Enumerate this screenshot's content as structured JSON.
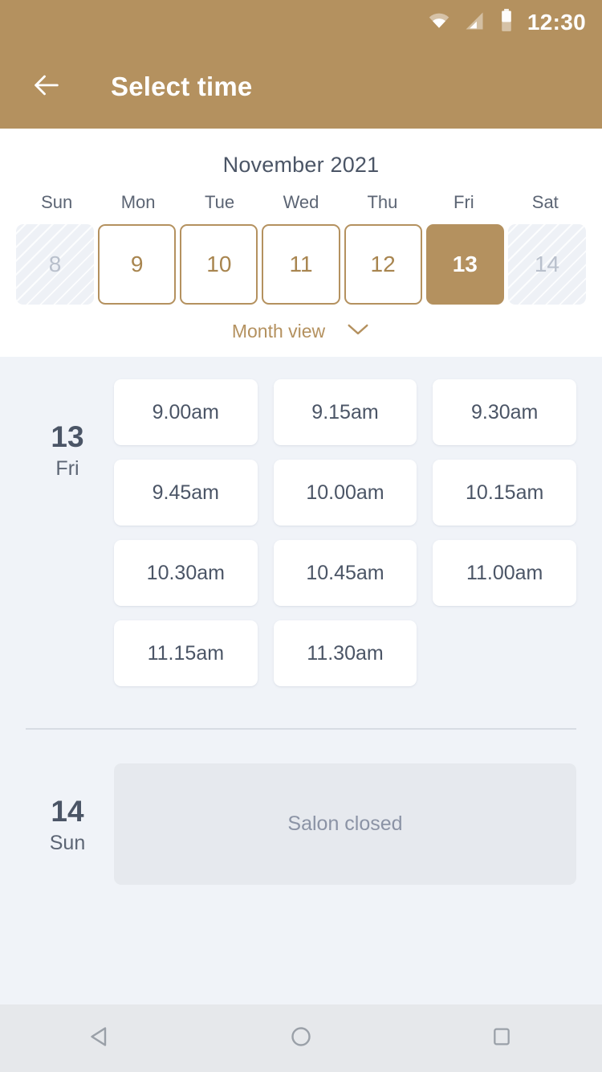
{
  "status_bar": {
    "time": "12:30",
    "icons": [
      "wifi-icon",
      "signal-icon",
      "battery-icon"
    ]
  },
  "app_bar": {
    "back_icon": "back-arrow-icon",
    "title": "Select time"
  },
  "calendar": {
    "month_title": "November 2021",
    "weekdays": [
      "Sun",
      "Mon",
      "Tue",
      "Wed",
      "Thu",
      "Fri",
      "Sat"
    ],
    "days": [
      {
        "number": "8",
        "state": "disabled"
      },
      {
        "number": "9",
        "state": "enabled"
      },
      {
        "number": "10",
        "state": "enabled"
      },
      {
        "number": "11",
        "state": "enabled"
      },
      {
        "number": "12",
        "state": "enabled"
      },
      {
        "number": "13",
        "state": "selected"
      },
      {
        "number": "14",
        "state": "disabled"
      }
    ],
    "view_toggle": {
      "label": "Month view",
      "icon": "chevron-down-icon"
    }
  },
  "schedule": [
    {
      "day_number": "13",
      "day_name": "Fri",
      "slots": [
        "9.00am",
        "9.15am",
        "9.30am",
        "9.45am",
        "10.00am",
        "10.15am",
        "10.30am",
        "10.45am",
        "11.00am",
        "11.15am",
        "11.30am"
      ]
    },
    {
      "day_number": "14",
      "day_name": "Sun",
      "closed_message": "Salon closed"
    }
  ],
  "nav_bar": {
    "back_icon": "nav-back-triangle-icon",
    "home_icon": "nav-home-circle-icon",
    "recents_icon": "nav-recents-square-icon"
  },
  "colors": {
    "brand": "#b4915f",
    "content_bg": "#f0f3f8",
    "text_dark": "#4b5566",
    "text_muted": "#8b93a5",
    "closed_card": "#e6e9ee"
  }
}
